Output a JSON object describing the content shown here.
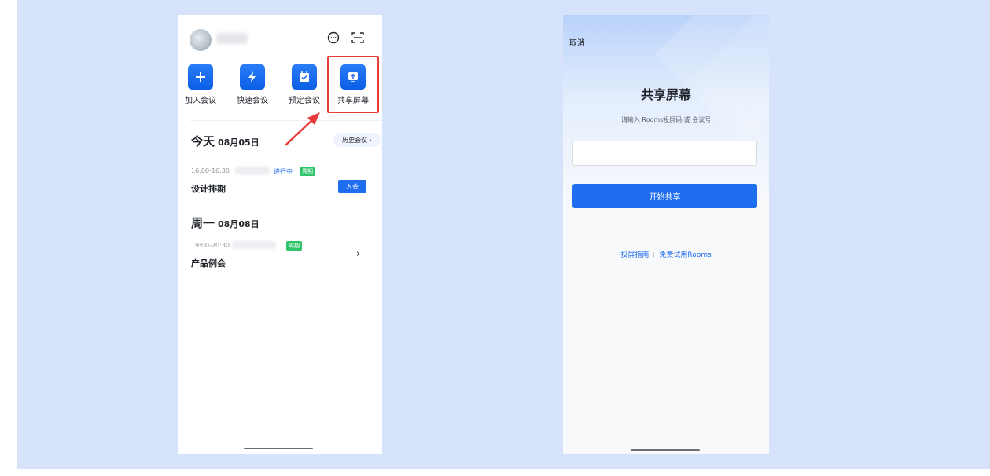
{
  "home": {
    "quick_actions": [
      {
        "label": "加入会议",
        "icon": "plus-icon"
      },
      {
        "label": "快速会议",
        "icon": "lightning-icon"
      },
      {
        "label": "预定会议",
        "icon": "calendar-check-icon"
      },
      {
        "label": "共享屏幕",
        "icon": "screen-share-icon"
      }
    ],
    "history_label": "历史会议 ›",
    "days": [
      {
        "title": "今天",
        "date": "08月05日",
        "meetings": [
          {
            "time": "16:00-16:30",
            "status": "进行中",
            "tag": "周期",
            "title": "设计排期",
            "action": "入会"
          }
        ]
      },
      {
        "title": "周一",
        "date": "08月08日",
        "meetings": [
          {
            "time": "19:00-20:30",
            "tag": "周期",
            "title": "产品例会",
            "action": "›"
          }
        ]
      }
    ]
  },
  "share_screen": {
    "cancel": "取消",
    "title": "共享屏幕",
    "subtitle": "请输入 Rooms投屏码 或 会议号",
    "input_value": "",
    "start_button": "开始共享",
    "link_guide": "投屏指南",
    "link_trial": "免费试用Rooms"
  },
  "colors": {
    "page_bg": "#d7e3fb",
    "primary": "#1f6ef0",
    "highlight": "#e63c3c",
    "tag_green": "#2ec56a"
  }
}
